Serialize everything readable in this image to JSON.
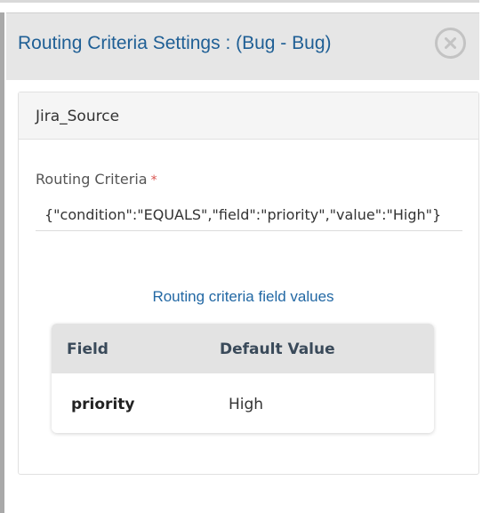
{
  "dialog": {
    "title": "Routing Criteria Settings : (Bug - Bug)",
    "close_icon": "close-circle-icon"
  },
  "source_panel": {
    "title": "Jira_Source",
    "routing_criteria": {
      "label": "Routing Criteria",
      "required_marker": "*",
      "value": "{\"condition\":\"EQUALS\",\"field\":\"priority\",\"value\":\"High\"}"
    },
    "field_values": {
      "caption": "Routing criteria field values",
      "columns": [
        "Field",
        "Default Value"
      ],
      "rows": [
        {
          "field": "priority",
          "default_value": "High"
        }
      ]
    }
  },
  "colors": {
    "title": "#1f5f95",
    "caption": "#2268a4",
    "required": "#d9534f",
    "header_bg": "#e6e6e6",
    "table_head_bg": "#e3e3e3"
  }
}
